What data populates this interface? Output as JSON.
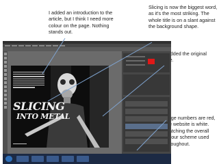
{
  "annotations": {
    "intro": "I added an introduction to the article, but I think I need more colour on the page. Nothing stands out.",
    "slicing": "Slicing is now the biggest word, as it's the most striking. The whole title is on a slant against the background shape.",
    "readded": "I re-added the original image.",
    "page_numbers": "Page numbers are red, the website is white. Matching the overall colour scheme used throughout."
  },
  "document": {
    "logo_line1": "SLICING",
    "logo_line2": "INTO METAL"
  },
  "colors": {
    "arrow": "#7fa3cf",
    "page_number_red": "#e01818"
  }
}
